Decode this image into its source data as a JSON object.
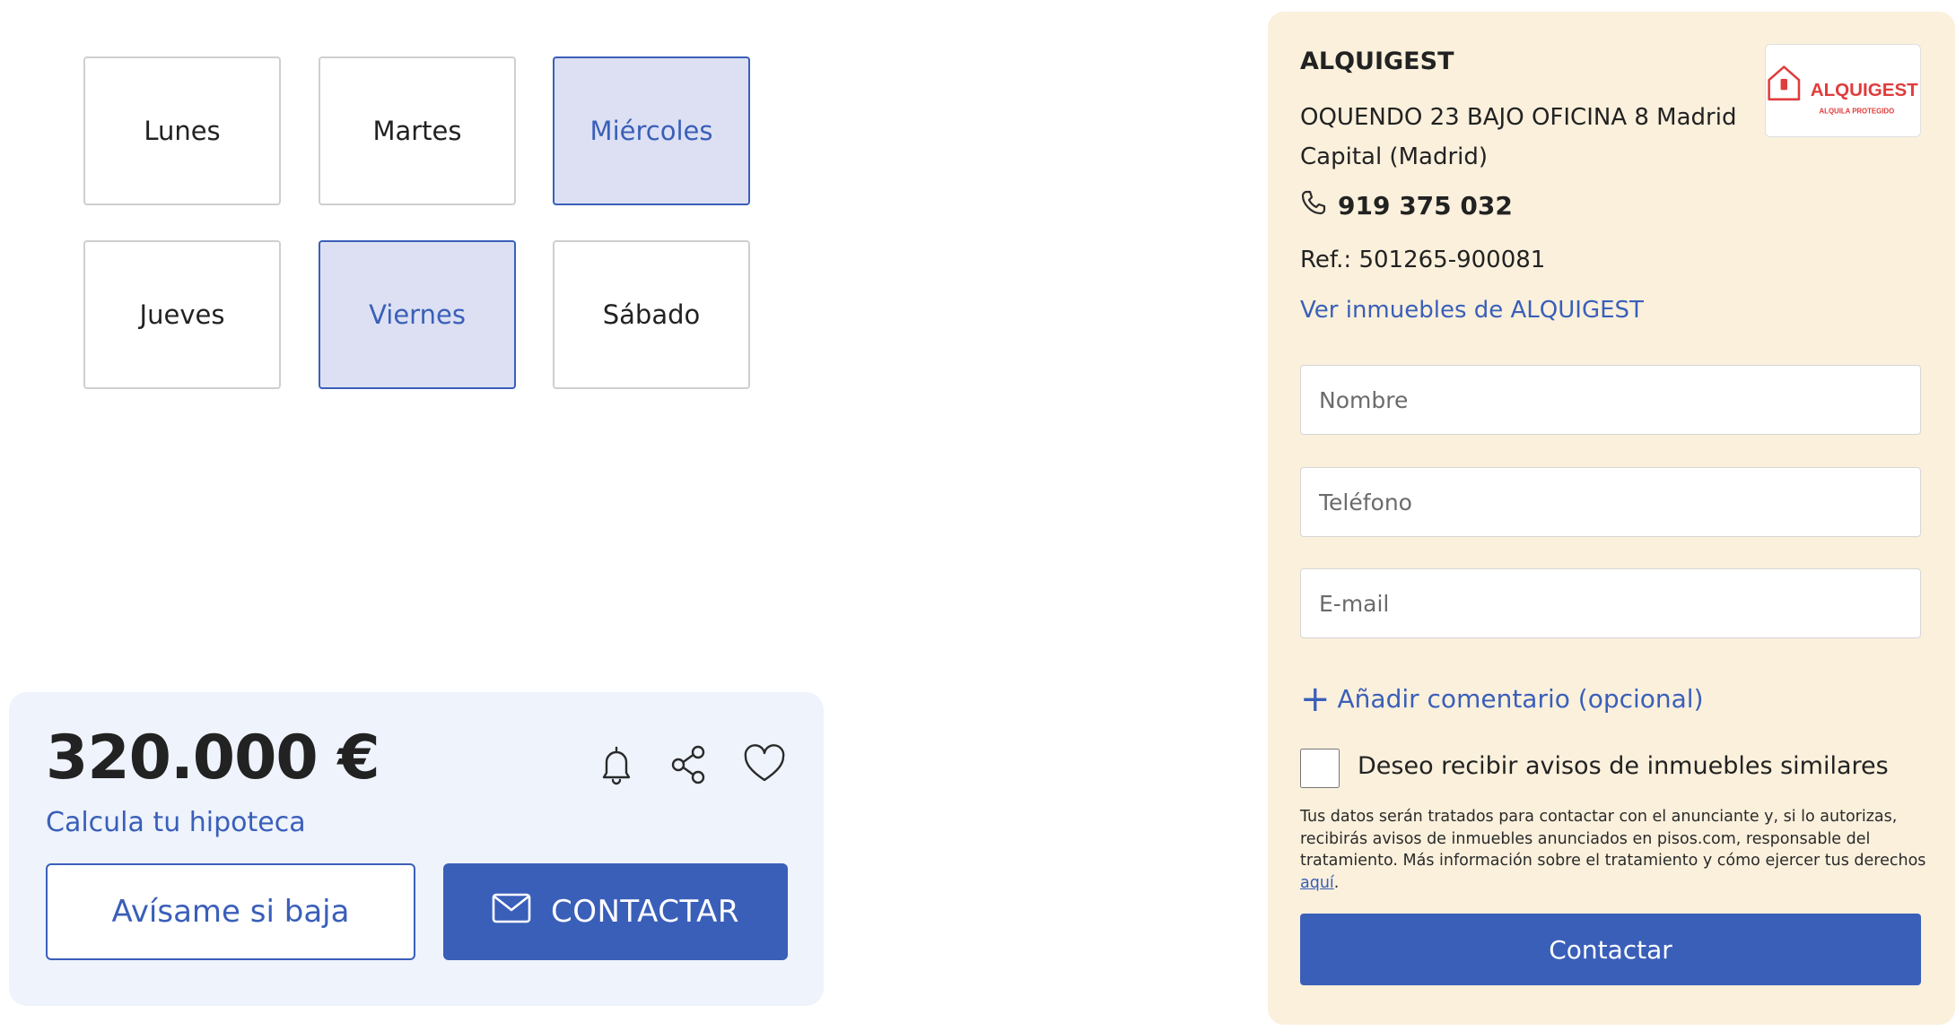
{
  "days": [
    {
      "label": "Lunes",
      "selected": false
    },
    {
      "label": "Martes",
      "selected": false
    },
    {
      "label": "Miércoles",
      "selected": true
    },
    {
      "label": "Jueves",
      "selected": false
    },
    {
      "label": "Viernes",
      "selected": true
    },
    {
      "label": "Sábado",
      "selected": false
    }
  ],
  "listing": {
    "price": "320.000 €",
    "mortgage_link": "Calcula tu hipoteca",
    "alert_button": "Avísame si baja",
    "contact_button": "CONTACTAR",
    "icons": [
      "bell-icon",
      "share-icon",
      "heart-icon",
      "mail-icon"
    ]
  },
  "agency": {
    "name": "ALQUIGEST",
    "address": "OQUENDO 23 BAJO OFICINA 8 Madrid Capital (Madrid)",
    "phone": "919 375 032",
    "ref": "Ref.: 501265-900081",
    "see_properties": "Ver inmuebles de ALQUIGEST",
    "logo_text": "ALQUIGEST",
    "logo_tagline": "ALQUILA PROTEGIDO"
  },
  "form": {
    "name_placeholder": "Nombre",
    "phone_placeholder": "Teléfono",
    "email_placeholder": "E-mail",
    "add_comment": "Añadir comentario (opcional)",
    "checkbox_label": "Deseo recibir avisos de inmuebles similares",
    "checkbox_checked": false,
    "legal_text": "Tus datos serán tratados para contactar con el anunciante y, si lo autorizas, recibirás avisos de inmuebles anunciados en pisos.com, responsable del tratamiento. Más información sobre el tratamiento y cómo ejercer tus derechos ",
    "legal_link": "aquí",
    "legal_end": ".",
    "submit": "Contactar"
  },
  "colors": {
    "accent": "#3a5fb9",
    "selected_day_bg": "#dce0f2",
    "price_card_bg": "#eef3fc",
    "agency_panel_bg": "#faf0dc",
    "logo_red": "#e03c3c"
  }
}
